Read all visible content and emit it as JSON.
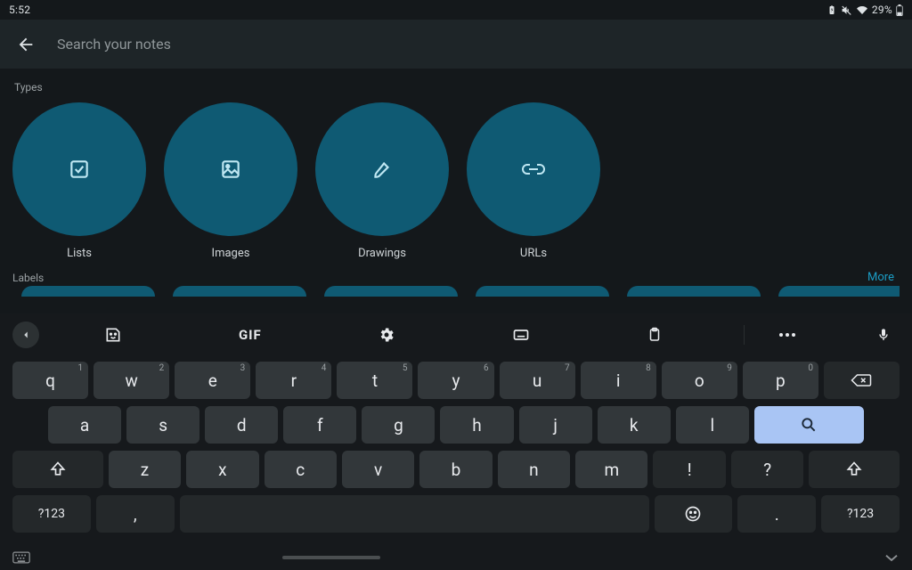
{
  "status": {
    "time": "5:52",
    "battery_pct": "29%"
  },
  "search": {
    "placeholder": "Search your notes"
  },
  "types": {
    "heading": "Types",
    "items": [
      {
        "name": "lists",
        "label": "Lists"
      },
      {
        "name": "images",
        "label": "Images"
      },
      {
        "name": "drawings",
        "label": "Drawings"
      },
      {
        "name": "urls",
        "label": "URLs"
      }
    ]
  },
  "labels": {
    "heading": "Labels",
    "more": "More"
  },
  "keyboard": {
    "gif": "GIF",
    "row1": [
      "q",
      "w",
      "e",
      "r",
      "t",
      "y",
      "u",
      "i",
      "o",
      "p"
    ],
    "hints1": [
      "1",
      "2",
      "3",
      "4",
      "5",
      "6",
      "7",
      "8",
      "9",
      "0"
    ],
    "row2": [
      "a",
      "s",
      "d",
      "f",
      "g",
      "h",
      "j",
      "k",
      "l"
    ],
    "row3": [
      "z",
      "x",
      "c",
      "v",
      "b",
      "n",
      "m"
    ],
    "sym": "?123",
    "comma": ",",
    "period": ".",
    "excl": "!",
    "qmark": "?"
  }
}
